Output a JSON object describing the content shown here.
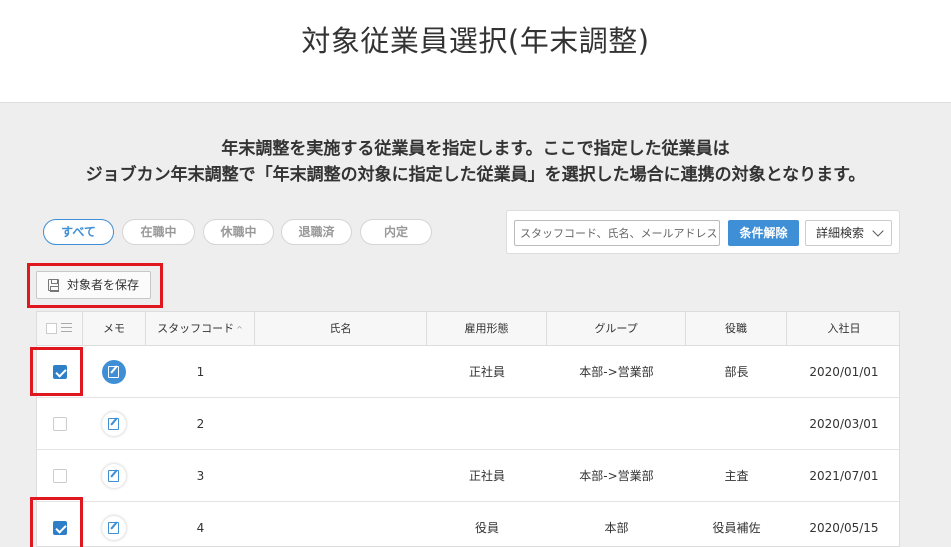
{
  "page": {
    "title": "対象従業員選択(年末調整)"
  },
  "description": {
    "line1": "年末調整を実施する従業員を指定します。ここで指定した従業員は",
    "line2": "ジョブカン年末調整で「年末調整の対象に指定した従業員」を選択した場合に連携の対象となります。"
  },
  "filters": [
    {
      "label": "すべて",
      "active": true
    },
    {
      "label": "在職中",
      "active": false
    },
    {
      "label": "休職中",
      "active": false
    },
    {
      "label": "退職済",
      "active": false
    },
    {
      "label": "内定",
      "active": false
    }
  ],
  "search": {
    "placeholder": "スタッフコード、氏名、メールアドレス",
    "value": "",
    "clear_label": "条件解除",
    "advanced_label": "詳細検索",
    "advanced_icon": "chevron-down-icon"
  },
  "save_button": {
    "label": "対象者を保存",
    "icon": "floppy-disk-icon"
  },
  "table": {
    "columns": {
      "memo": "メモ",
      "staff_code": "スタッフコード",
      "name": "氏名",
      "employment_type": "雇用形態",
      "group": "グループ",
      "position": "役職",
      "hire_date": "入社日"
    },
    "sort_indicator": "^",
    "rows": [
      {
        "checked": true,
        "memo_filled": true,
        "staff_code": "1",
        "name": "",
        "employment_type": "正社員",
        "group": "本部->営業部",
        "position": "部長",
        "hire_date": "2020/01/01"
      },
      {
        "checked": false,
        "memo_filled": false,
        "staff_code": "2",
        "name": "",
        "employment_type": "",
        "group": "",
        "position": "",
        "hire_date": "2020/03/01"
      },
      {
        "checked": false,
        "memo_filled": false,
        "staff_code": "3",
        "name": "",
        "employment_type": "正社員",
        "group": "本部->営業部",
        "position": "主査",
        "hire_date": "2021/07/01"
      },
      {
        "checked": true,
        "memo_filled": false,
        "staff_code": "4",
        "name": "",
        "employment_type": "役員",
        "group": "本部",
        "position": "役員補佐",
        "hire_date": "2020/05/15"
      }
    ]
  },
  "colors": {
    "accent": "#3f8fd6",
    "highlight": "#e0171f",
    "background": "#eeeeee"
  }
}
